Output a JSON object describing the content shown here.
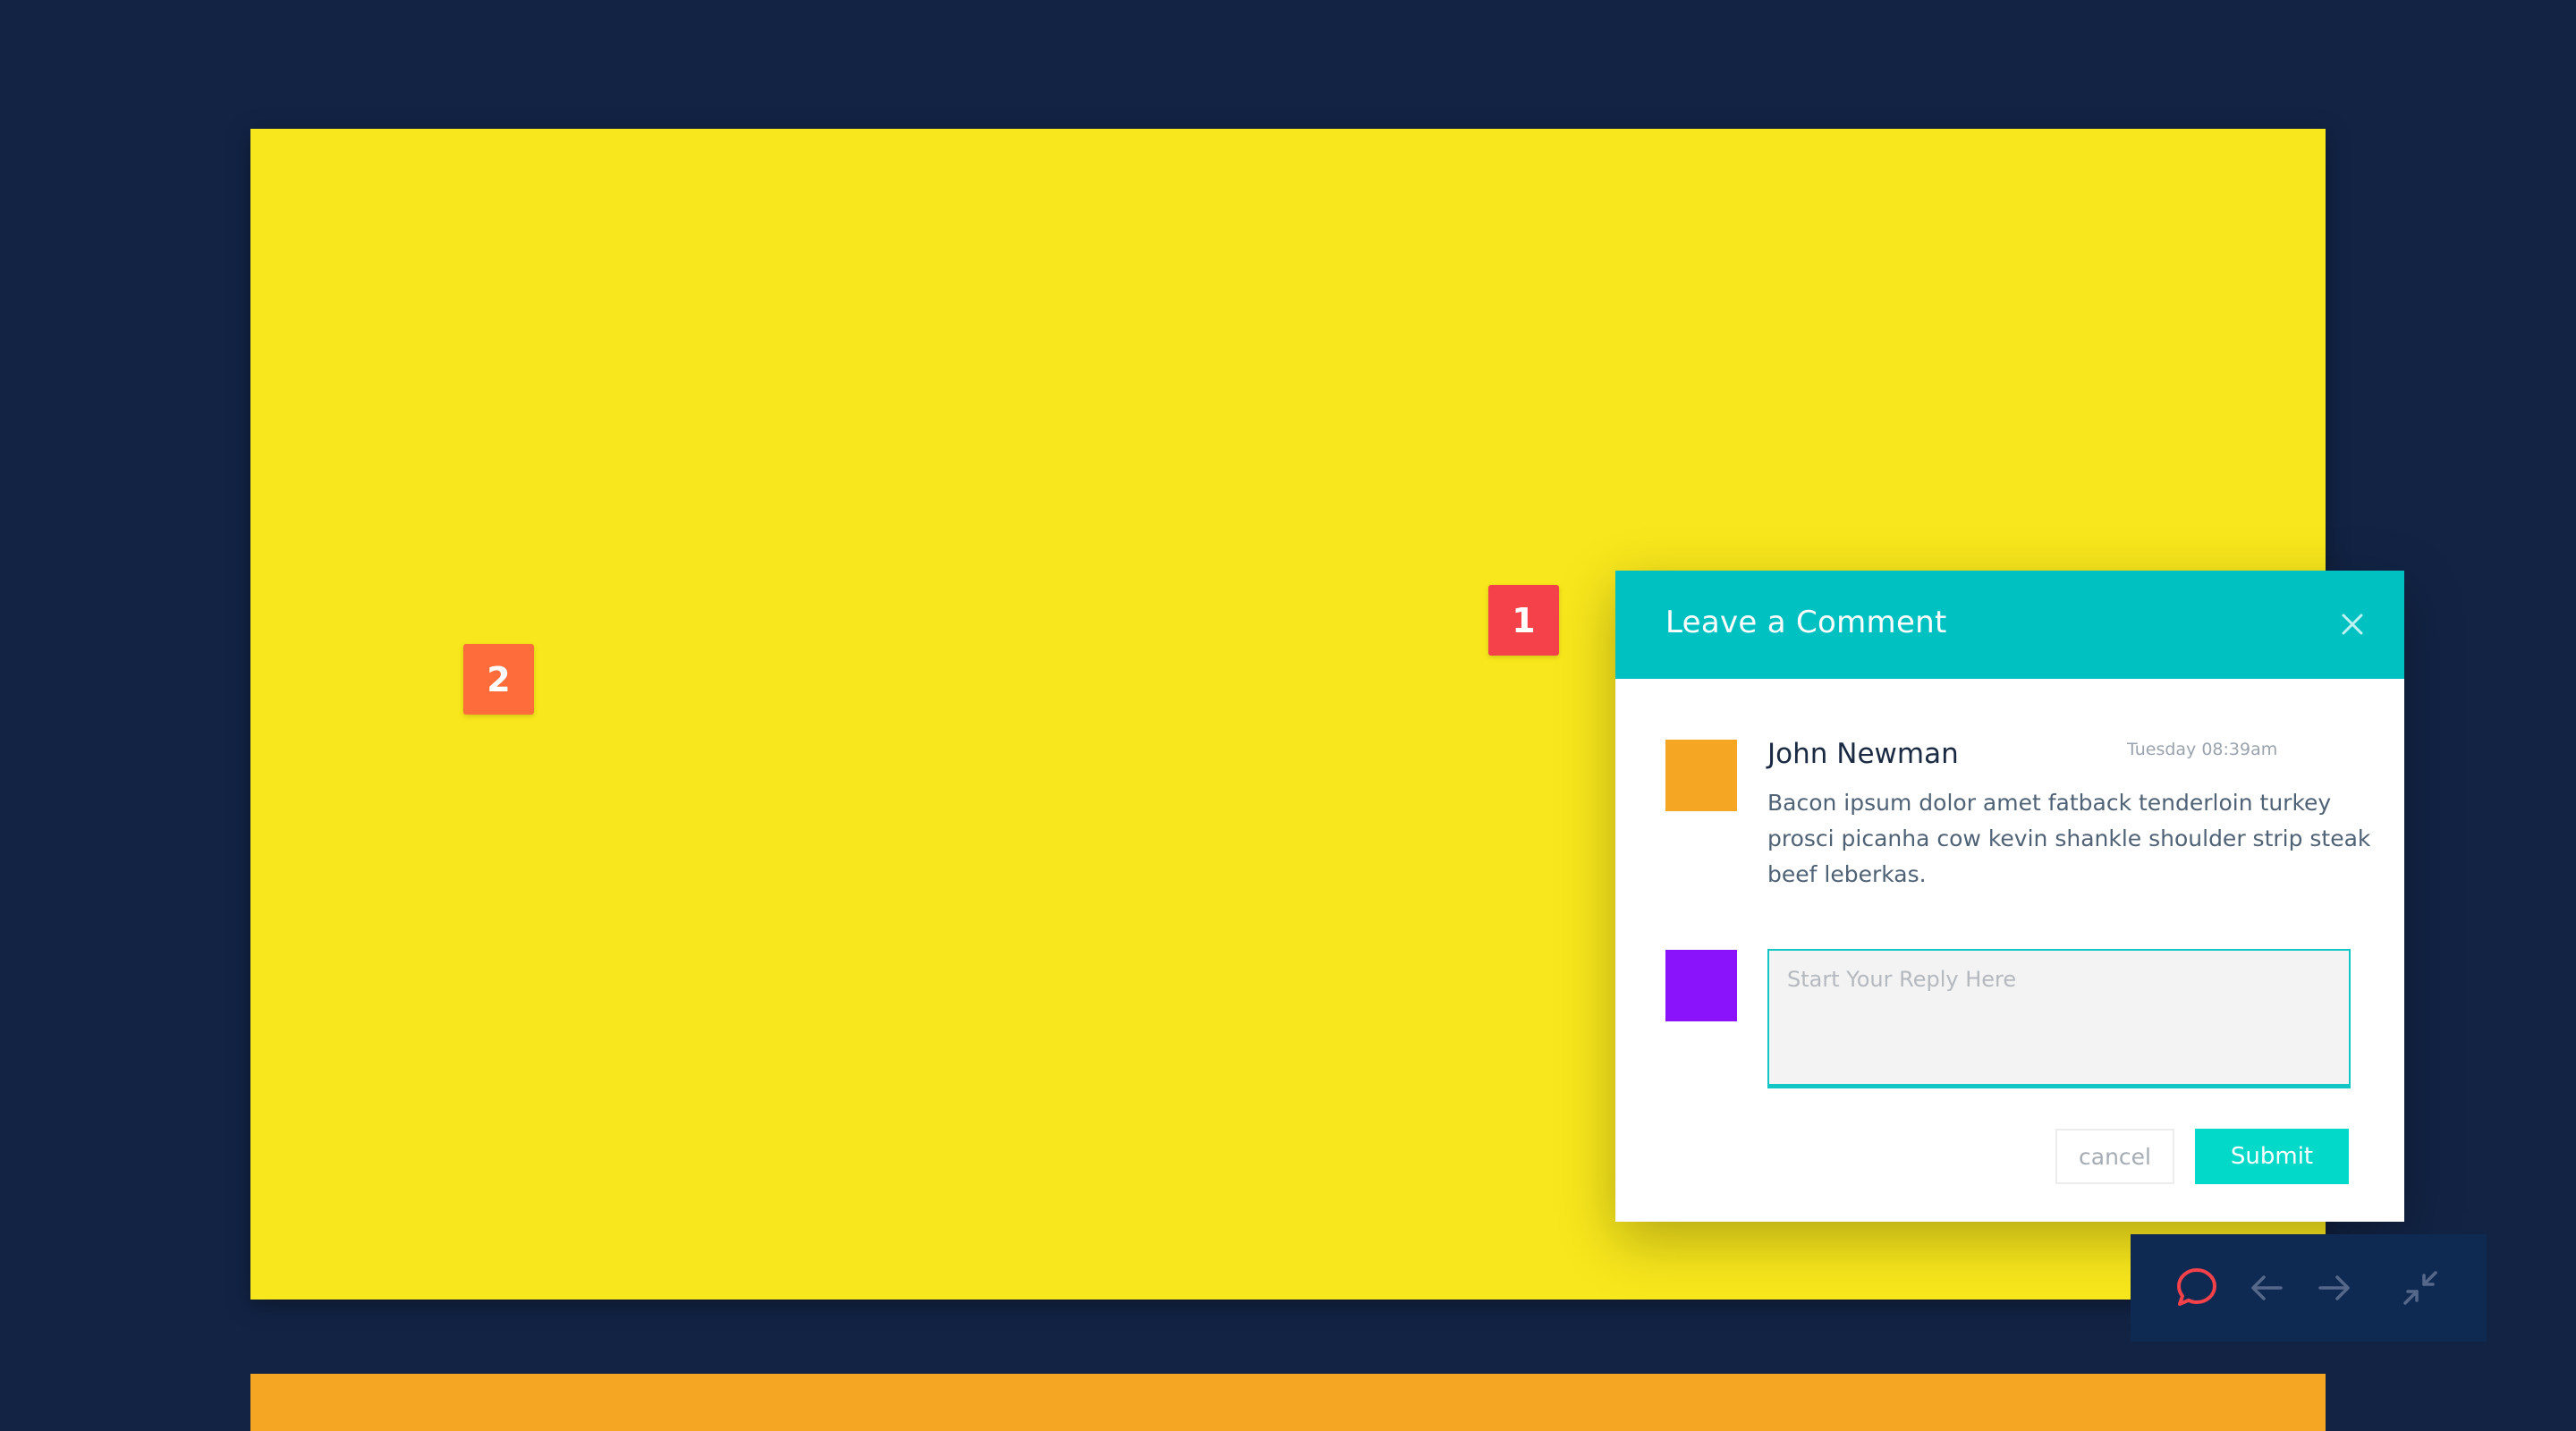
{
  "pins": [
    {
      "label": "1",
      "color": "#f5414a"
    },
    {
      "label": "2",
      "color": "#fd6c3a"
    }
  ],
  "dialog": {
    "title": "Leave a Comment",
    "close_icon": "close-icon",
    "header_color": "#00c1c1",
    "comment": {
      "author": "John Newman",
      "time": "Tuesday 08:39am",
      "body": "Bacon ipsum dolor amet fatback tenderloin  turkey prosci picanha cow kevin shankle shoulder strip steak beef leberkas.",
      "avatar_color": "#f5a623"
    },
    "reply": {
      "placeholder": "Start Your Reply Here",
      "value": "",
      "avatar_color": "#8b13fb"
    },
    "cancel_label": "cancel",
    "submit_label": "Submit",
    "accent_color": "#03d9c9"
  },
  "toolbar": {
    "items": [
      {
        "icon": "comment-bubble-icon",
        "active": true,
        "color": "#f5414a"
      },
      {
        "icon": "arrow-left-icon",
        "active": false
      },
      {
        "icon": "arrow-right-icon",
        "active": false
      },
      {
        "icon": "collapse-icon",
        "active": false
      }
    ]
  },
  "colors": {
    "background": "#122344",
    "board_yellow": "#f8e71c",
    "board_orange": "#f5a623",
    "toolbar_bg": "#0f2a52"
  }
}
